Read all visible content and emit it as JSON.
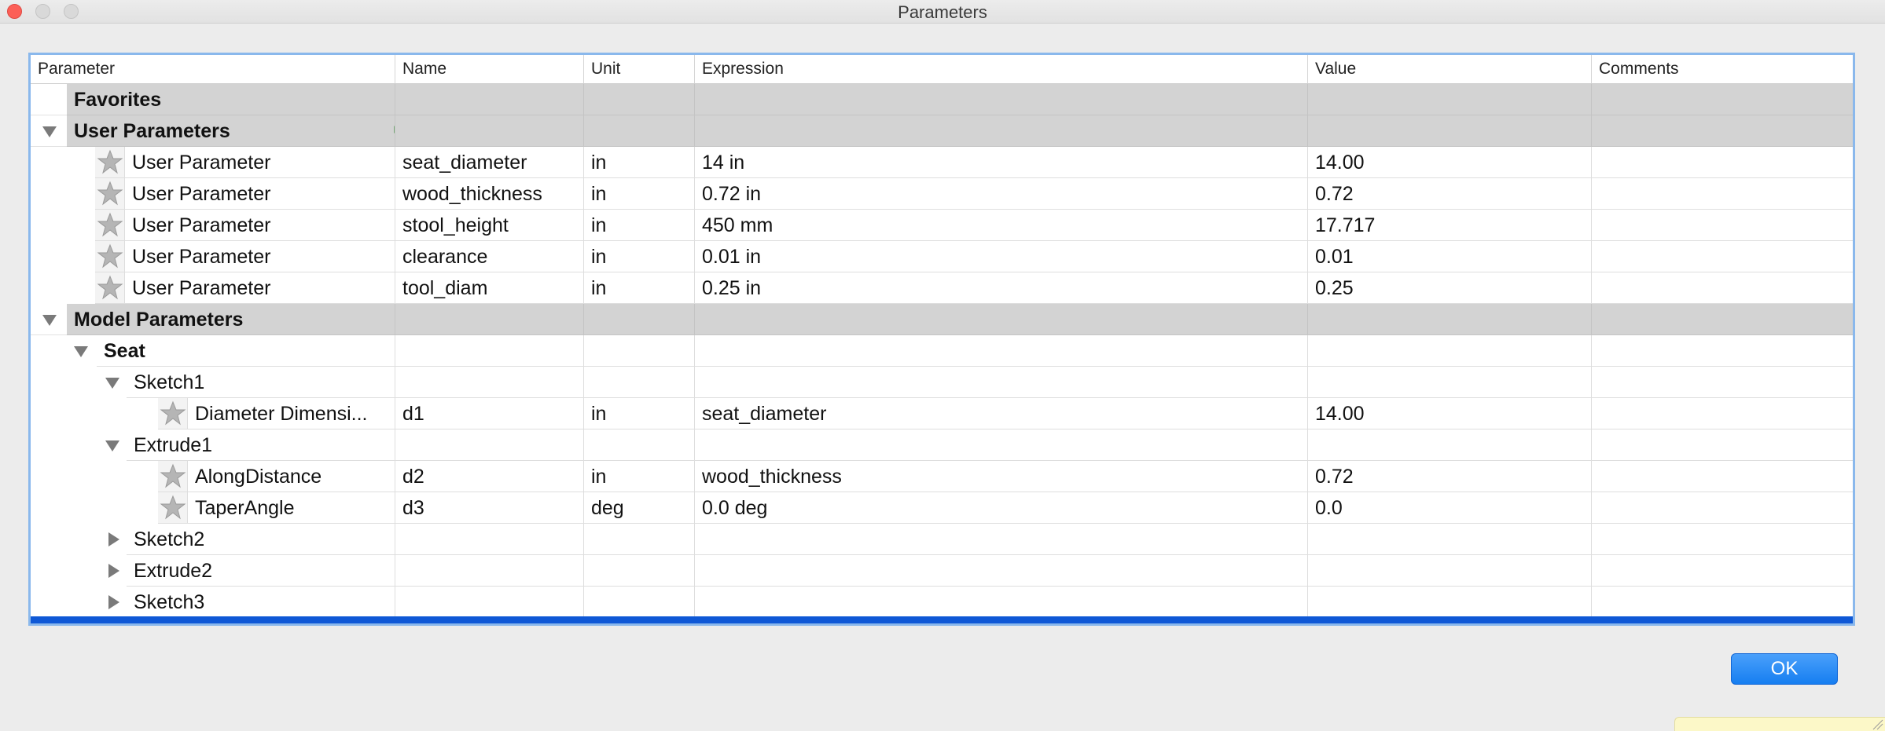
{
  "window": {
    "title": "Parameters"
  },
  "columns": [
    "Parameter",
    "Name",
    "Unit",
    "Expression",
    "Value",
    "Comments"
  ],
  "groups": {
    "favorites": "Favorites",
    "user_parameters": "User Parameters",
    "model_parameters": "Model Parameters"
  },
  "user_parameters": [
    {
      "parameter": "User Parameter",
      "name": "seat_diameter",
      "unit": "in",
      "expression": "14 in",
      "value": "14.00"
    },
    {
      "parameter": "User Parameter",
      "name": "wood_thickness",
      "unit": "in",
      "expression": "0.72 in",
      "value": "0.72"
    },
    {
      "parameter": "User Parameter",
      "name": "stool_height",
      "unit": "in",
      "expression": "450 mm",
      "value": "17.717"
    },
    {
      "parameter": "User Parameter",
      "name": "clearance",
      "unit": "in",
      "expression": "0.01 in",
      "value": "0.01"
    },
    {
      "parameter": "User Parameter",
      "name": "tool_diam",
      "unit": "in",
      "expression": "0.25 in",
      "value": "0.25"
    }
  ],
  "model": {
    "component": "Seat",
    "sketch1": "Sketch1",
    "sketch1_params": [
      {
        "parameter": "Diameter Dimensi...",
        "name": "d1",
        "unit": "in",
        "expression": "seat_diameter",
        "value": "14.00"
      }
    ],
    "extrude1": "Extrude1",
    "extrude1_params": [
      {
        "parameter": "AlongDistance",
        "name": "d2",
        "unit": "in",
        "expression": "wood_thickness",
        "value": "0.72"
      },
      {
        "parameter": "TaperAngle",
        "name": "d3",
        "unit": "deg",
        "expression": "0.0 deg",
        "value": "0.0"
      }
    ],
    "sketch2": "Sketch2",
    "extrude2": "Extrude2",
    "sketch3": "Sketch3"
  },
  "buttons": {
    "ok": "OK"
  },
  "icons": {
    "favorite": "star-icon",
    "add": "plus-icon",
    "expand": "triangle-down-icon",
    "collapse": "triangle-right-icon"
  },
  "colors": {
    "add_icon": "#2eae2e",
    "selection_strip": "#0f58d6",
    "ok_button": "#1a82f2"
  }
}
